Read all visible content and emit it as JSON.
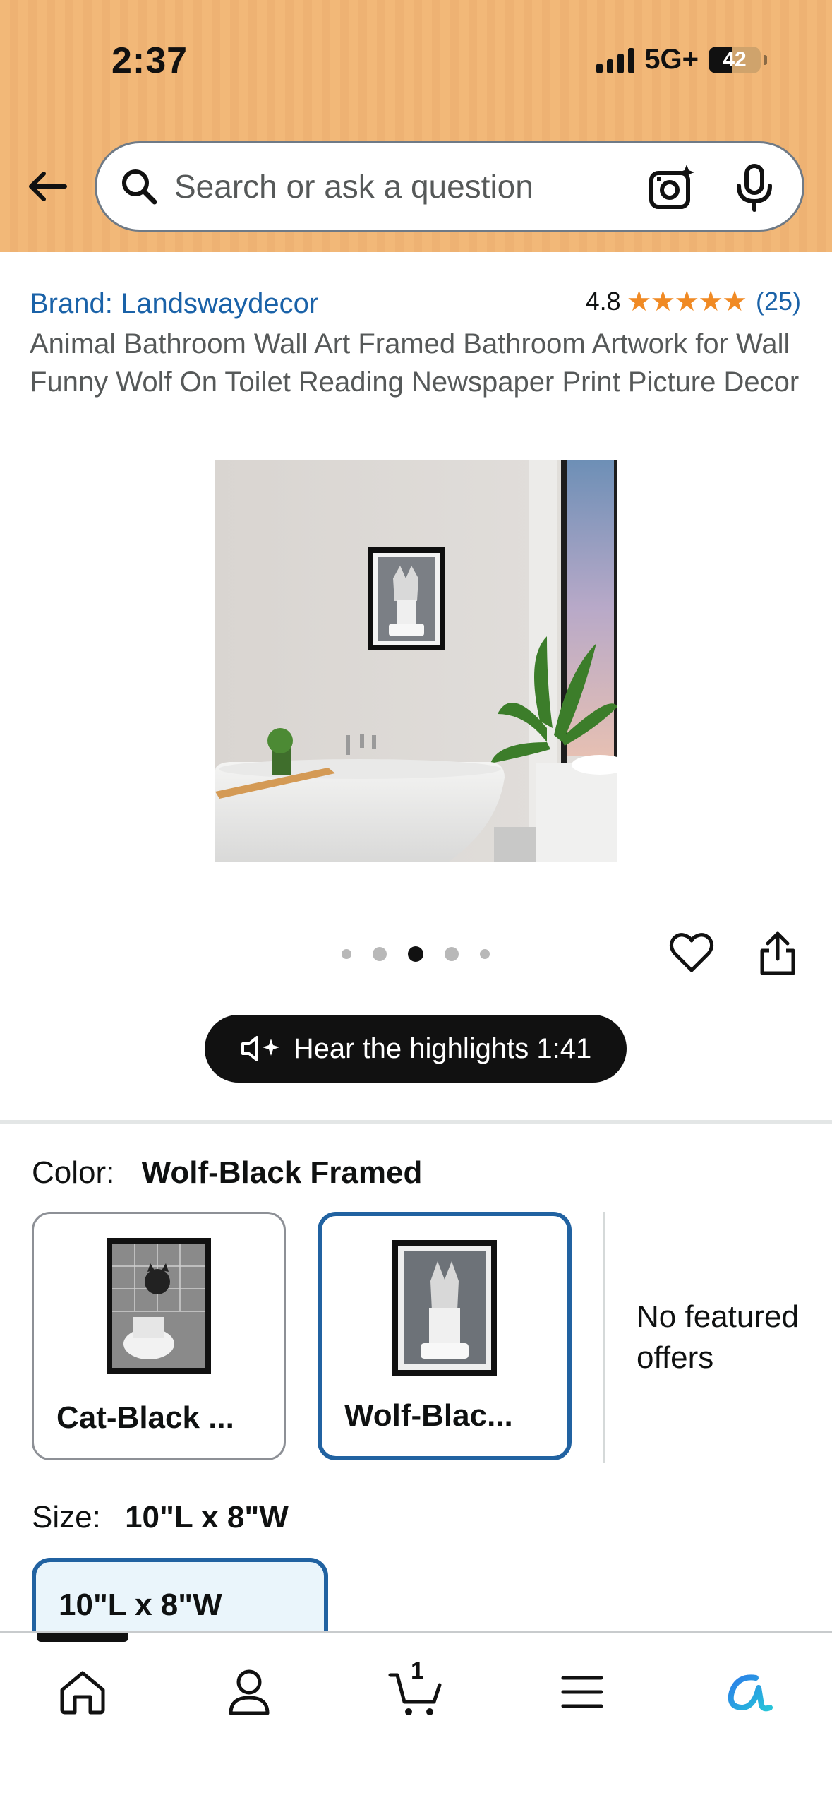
{
  "status_bar": {
    "time": "2:37",
    "network": "5G+",
    "battery": "42"
  },
  "search": {
    "placeholder": "Search or ask a question"
  },
  "product": {
    "brand": "Brand: Landswaydecor",
    "rating_value": "4.8",
    "stars": "★★★★★",
    "rating_count": "(25)",
    "title": "Animal Bathroom Wall Art Framed Bathroom Artwork for Wall Funny Wolf On Toilet Reading Newspaper Print Picture Decor",
    "image_count": 5,
    "current_image": 3
  },
  "audio": {
    "label": "Hear the highlights 1:41"
  },
  "color": {
    "label": "Color:",
    "selected": "Wolf-Black Framed",
    "options": [
      {
        "name": "Cat-Black ..."
      },
      {
        "name": "Wolf-Blac..."
      }
    ],
    "no_offers": "No featured offers"
  },
  "size": {
    "label": "Size:",
    "selected": "10\"L x 8\"W",
    "chip": "10\"L x 8\"W"
  },
  "bottom_nav": {
    "cart_count": "1",
    "items": [
      "home-icon",
      "profile-icon",
      "cart-icon",
      "menu-icon",
      "alexa-icon"
    ]
  },
  "colors": {
    "header": "#f2b878",
    "link": "#1a62a8",
    "star": "#f08a24",
    "selected_border": "#2162a1"
  }
}
